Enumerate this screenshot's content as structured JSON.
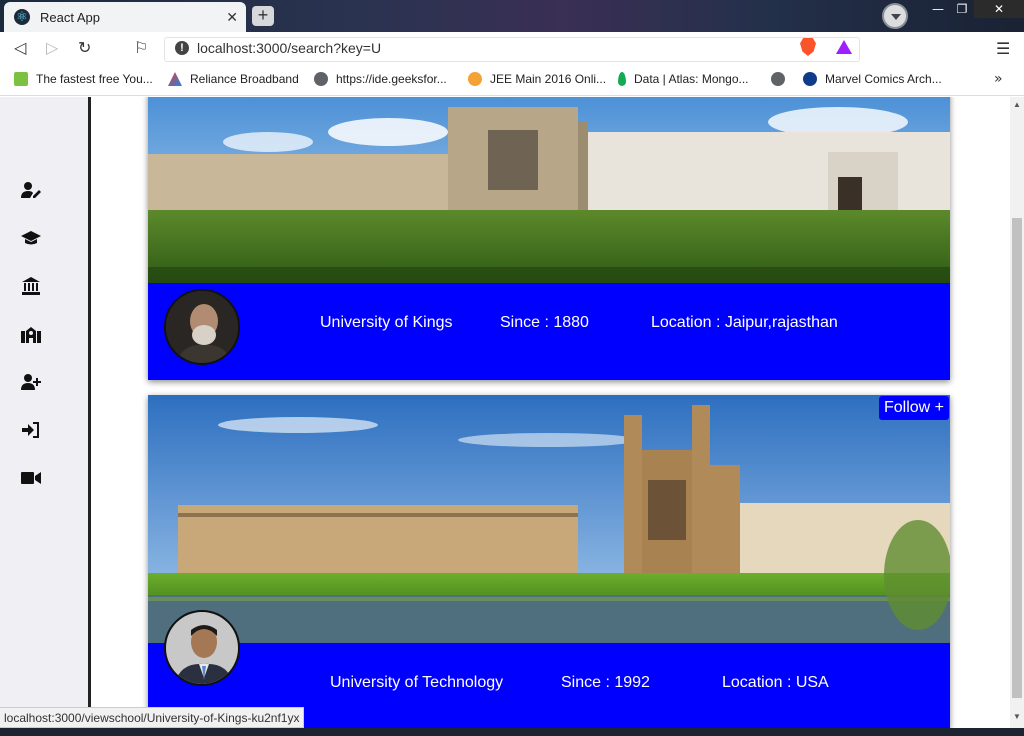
{
  "browser": {
    "tab_title": "React App",
    "url": "localhost:3000/search?key=U",
    "bookmarks": [
      {
        "label": "The fastest free You..."
      },
      {
        "label": "Reliance Broadband"
      },
      {
        "label": "https://ide.geeksfor..."
      },
      {
        "label": "JEE Main 2016 Onli..."
      },
      {
        "label": "Data | Atlas: Mongo..."
      },
      {
        "label": ""
      },
      {
        "label": "Marvel Comics Arch..."
      }
    ],
    "status_url": "localhost:3000/viewschool/University-of-Kings-ku2nf1yx"
  },
  "sidebar": {
    "items": [
      {
        "icon": "user-edit-icon"
      },
      {
        "icon": "graduation-cap-icon"
      },
      {
        "icon": "university-icon"
      },
      {
        "icon": "school-icon"
      },
      {
        "icon": "user-plus-icon"
      },
      {
        "icon": "sign-in-icon"
      },
      {
        "icon": "video-camera-icon"
      }
    ]
  },
  "results": [
    {
      "name": "University of Kings",
      "since": "Since : 1880",
      "location": "Location : Jaipur,rajasthan",
      "follow_label": ""
    },
    {
      "name": "University of Technology",
      "since": "Since : 1992",
      "location": "Location : USA",
      "follow_label": "Follow +"
    }
  ],
  "colors": {
    "info_bar": "#0000ff",
    "sidebar_bg": "#f0f0f4"
  }
}
